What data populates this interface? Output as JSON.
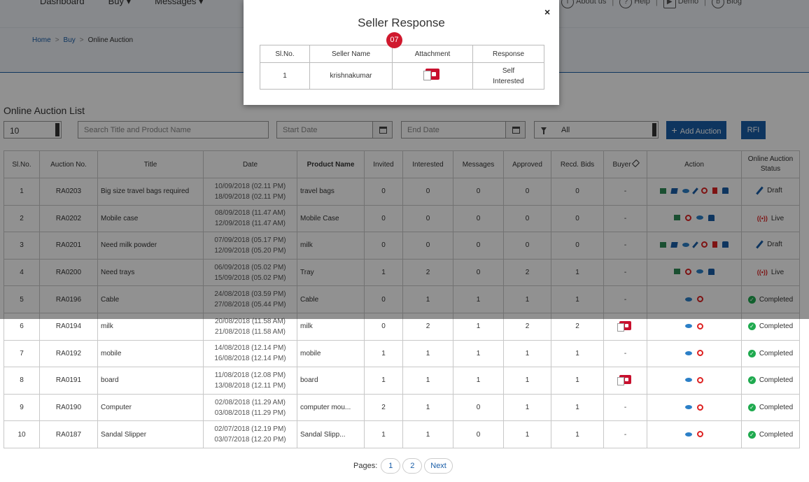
{
  "topnav": {
    "menu": [
      "Dashboard",
      "Buy",
      "Messages"
    ],
    "right": [
      {
        "icon": "info-icon",
        "label": "About us"
      },
      {
        "icon": "help-icon",
        "label": "Help"
      },
      {
        "icon": "demo-icon",
        "label": "Demo"
      },
      {
        "icon": "blog-icon",
        "label": "Blog"
      }
    ]
  },
  "breadcrumb": {
    "home": "Home",
    "buy": "Buy",
    "current": "Online Auction",
    "sep": ">"
  },
  "list_title": "Online Auction List",
  "filters": {
    "per_page": "10",
    "search_placeholder": "Search Title and Product Name",
    "start_placeholder": "Start Date",
    "end_placeholder": "End Date",
    "status_filter": "All",
    "add_label": "Add Auction",
    "rfi_label": "RFI"
  },
  "table": {
    "headers": [
      "Sl.No.",
      "Auction No.",
      "Title",
      "Date",
      "Product Name",
      "Invited",
      "Interested",
      "Messages",
      "Approved",
      "Recd. Bids",
      "Buyer",
      "Action",
      "Online Auction Status"
    ],
    "rows": [
      {
        "sl": "1",
        "no": "RA0203",
        "title": "Big size travel bags required",
        "d1": "10/09/2018 (02.11 PM)",
        "d2": "18/09/2018 (02.11 PM)",
        "product": "travel bags",
        "invited": "0",
        "interested": "0",
        "messages": "0",
        "approved": "0",
        "bids": "0",
        "buyer": "-",
        "status": "Draft"
      },
      {
        "sl": "2",
        "no": "RA0202",
        "title": "Mobile case",
        "d1": "08/09/2018 (11.47 AM)",
        "d2": "12/09/2018 (11.47 AM)",
        "product": "Mobile Case",
        "invited": "0",
        "interested": "0",
        "messages": "0",
        "approved": "0",
        "bids": "0",
        "buyer": "-",
        "status": "Live"
      },
      {
        "sl": "3",
        "no": "RA0201",
        "title": "Need milk powder",
        "d1": "07/09/2018 (05.17 PM)",
        "d2": "12/09/2018 (05.20 PM)",
        "product": "milk",
        "invited": "0",
        "interested": "0",
        "messages": "0",
        "approved": "0",
        "bids": "0",
        "buyer": "-",
        "status": "Draft"
      },
      {
        "sl": "4",
        "no": "RA0200",
        "title": "Need trays",
        "d1": "06/09/2018 (05.02 PM)",
        "d2": "15/09/2018 (05.02 PM)",
        "product": "Tray",
        "invited": "1",
        "interested": "2",
        "messages": "0",
        "approved": "2",
        "bids": "1",
        "buyer": "-",
        "status": "Live"
      },
      {
        "sl": "5",
        "no": "RA0196",
        "title": "Cable",
        "d1": "24/08/2018 (03.59 PM)",
        "d2": "27/08/2018 (05.44 PM)",
        "product": "Cable",
        "invited": "0",
        "interested": "1",
        "messages": "1",
        "approved": "1",
        "bids": "1",
        "buyer": "-",
        "status": "Completed"
      },
      {
        "sl": "6",
        "no": "RA0194",
        "title": "milk",
        "d1": "20/08/2018 (11.58 AM)",
        "d2": "21/08/2018 (11.58 AM)",
        "product": "milk",
        "invited": "0",
        "interested": "2",
        "messages": "1",
        "approved": "2",
        "bids": "2",
        "buyer": "pdf",
        "status": "Completed"
      },
      {
        "sl": "7",
        "no": "RA0192",
        "title": "mobile",
        "d1": "14/08/2018 (12.14 PM)",
        "d2": "16/08/2018 (12.14 PM)",
        "product": "mobile",
        "invited": "1",
        "interested": "1",
        "messages": "1",
        "approved": "1",
        "bids": "1",
        "buyer": "-",
        "status": "Completed"
      },
      {
        "sl": "8",
        "no": "RA0191",
        "title": "board",
        "d1": "11/08/2018 (12.08 PM)",
        "d2": "13/08/2018 (12.11 PM)",
        "product": "board",
        "invited": "1",
        "interested": "1",
        "messages": "1",
        "approved": "1",
        "bids": "1",
        "buyer": "pdf",
        "status": "Completed"
      },
      {
        "sl": "9",
        "no": "RA0190",
        "title": "Computer",
        "d1": "02/08/2018 (11.29 AM)",
        "d2": "03/08/2018 (11.29 PM)",
        "product": "computer mou...",
        "invited": "2",
        "interested": "1",
        "messages": "0",
        "approved": "1",
        "bids": "1",
        "buyer": "-",
        "status": "Completed"
      },
      {
        "sl": "10",
        "no": "RA0187",
        "title": "Sandal Slipper",
        "d1": "02/07/2018 (12.19 PM)",
        "d2": "03/07/2018 (12.20 PM)",
        "product": "Sandal Slipp...",
        "invited": "1",
        "interested": "1",
        "messages": "0",
        "approved": "1",
        "bids": "1",
        "buyer": "-",
        "status": "Completed"
      }
    ]
  },
  "pager": {
    "label": "Pages:",
    "pages": [
      "1",
      "2"
    ],
    "next": "Next"
  },
  "modal": {
    "title": "Seller Response",
    "close": "×",
    "badge": "07",
    "headers": [
      "Sl.No.",
      "Seller Name",
      "Attachment",
      "Response"
    ],
    "row": {
      "sl": "1",
      "seller": "krishnakumar",
      "response_line1": "Self",
      "response_line2": "Interested"
    }
  },
  "colors": {
    "primary": "#1a5ea8",
    "danger": "#d0192e",
    "success": "#1faa4f"
  }
}
